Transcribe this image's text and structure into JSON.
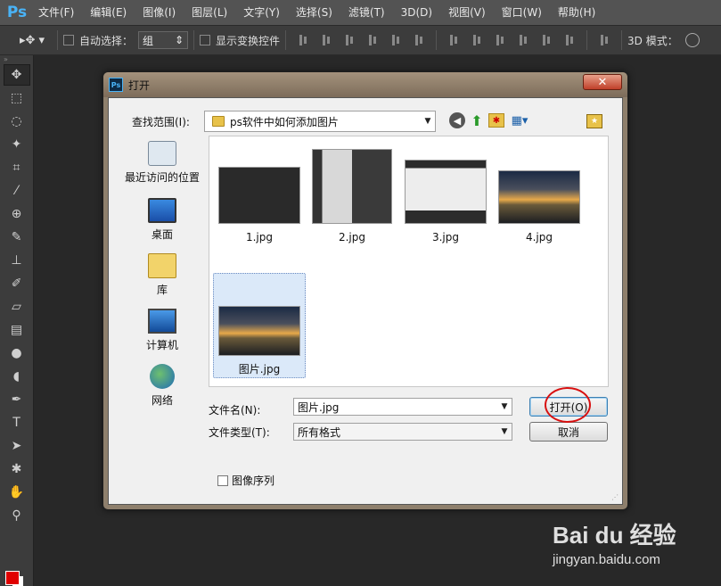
{
  "app": {
    "logo": "Ps",
    "menu": [
      "文件(F)",
      "编辑(E)",
      "图像(I)",
      "图层(L)",
      "文字(Y)",
      "选择(S)",
      "滤镜(T)",
      "3D(D)",
      "视图(V)",
      "窗口(W)",
      "帮助(H)"
    ]
  },
  "options_bar": {
    "auto_select_label": "自动选择：",
    "auto_select_value": "组",
    "show_transform_label": "显示变换控件",
    "mode_3d_label": "3D 模式："
  },
  "tools": [
    "move-tool",
    "marquee-tool",
    "lasso-tool",
    "magic-wand-tool",
    "crop-tool",
    "eyedropper-tool",
    "healing-brush-tool",
    "brush-tool",
    "clone-stamp-tool",
    "history-brush-tool",
    "eraser-tool",
    "gradient-tool",
    "blur-tool",
    "dodge-tool",
    "pen-tool",
    "type-tool",
    "path-selection-tool",
    "shape-tool",
    "hand-tool",
    "zoom-tool"
  ],
  "colors": {
    "foreground": "#e00000",
    "background": "#ffffff",
    "highlight_ring": "#d81010"
  },
  "dialog": {
    "title": "打开",
    "close_label": "✕",
    "look_in_label": "查找范围(I):",
    "look_in_value": "ps软件中如何添加图片",
    "places": [
      {
        "label": "最近访问的位置",
        "icon": "recent-places-icon"
      },
      {
        "label": "桌面",
        "icon": "desktop-icon"
      },
      {
        "label": "库",
        "icon": "libraries-icon"
      },
      {
        "label": "计算机",
        "icon": "computer-icon"
      },
      {
        "label": "网络",
        "icon": "network-icon"
      }
    ],
    "files": [
      {
        "name": "1.jpg",
        "thumb": "dark"
      },
      {
        "name": "2.jpg",
        "thumb": "shot2"
      },
      {
        "name": "3.jpg",
        "thumb": "shot3"
      },
      {
        "name": "4.jpg",
        "thumb": "sunset"
      },
      {
        "name": "图片.jpg",
        "thumb": "sunset",
        "selected": true
      }
    ],
    "filename_label": "文件名(N):",
    "filename_value": "图片.jpg",
    "filetype_label": "文件类型(T):",
    "filetype_value": "所有格式",
    "open_button": "打开(O)",
    "cancel_button": "取消",
    "image_sequence_label": "图像序列"
  },
  "watermark": {
    "logo": "Bai du 经验",
    "url": "jingyan.baidu.com"
  }
}
